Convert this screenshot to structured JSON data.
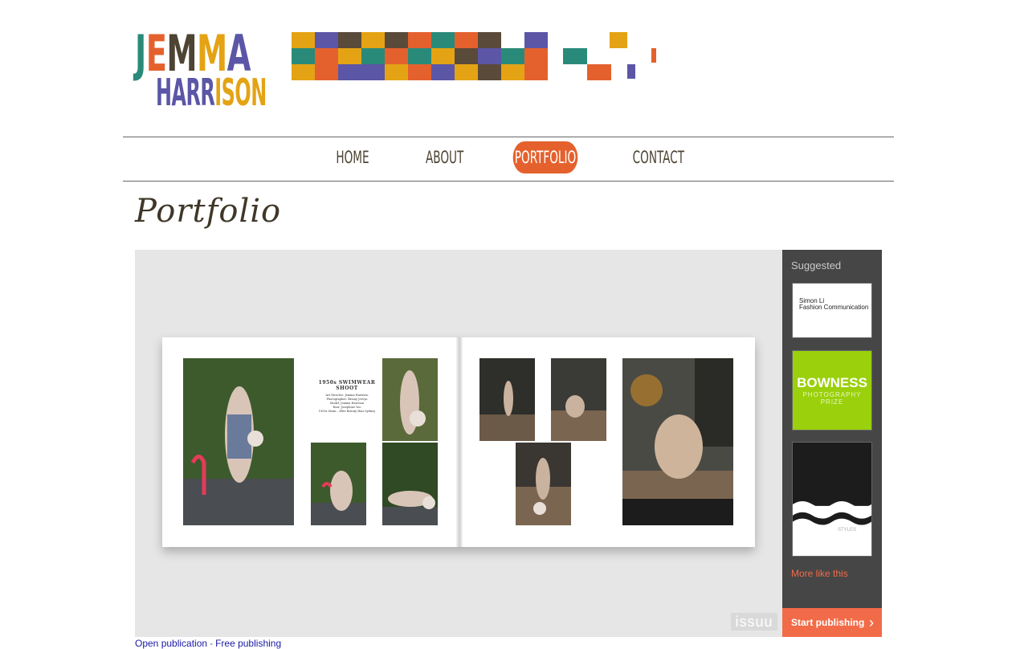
{
  "logo": {
    "line1": [
      "J",
      "E",
      "M",
      "M",
      "A"
    ],
    "line1_colors": [
      "#2a8a7a",
      "#e4612e",
      "#4e4434",
      "#e4a314",
      "#5b56a6"
    ],
    "line2": [
      "H",
      "A",
      "R",
      "R",
      "I",
      "S",
      "O",
      "N"
    ],
    "line2_colors": [
      "#5b56a6",
      "#5b56a6",
      "#5b56a6",
      "#5b56a6",
      "#e4a314",
      "#e4a314",
      "#e4a314",
      "#e4a314"
    ]
  },
  "colors": {
    "accent": "#e4612e",
    "teal": "#2a8a7a",
    "yellow": "#e4a314",
    "purple": "#5b56a6",
    "brown": "#5a4a3a",
    "nav_text": "#4e4434",
    "issuu_orange": "#f26b48",
    "issuu_panel": "#464646",
    "viewer_bg": "#e6e6e6"
  },
  "nav": {
    "items": [
      {
        "label": "Home",
        "active": false
      },
      {
        "label": "About",
        "active": false
      },
      {
        "label": "Portfolio",
        "active": true
      },
      {
        "label": "Contact",
        "active": false
      }
    ]
  },
  "page": {
    "title": "Portfolio"
  },
  "publication": {
    "shoot_title": "1950s SWIMWEAR SHOOT",
    "credits": [
      "Art Director: Jemma Harrison",
      "Photographer: Briony Jervyn",
      "Model: Jemma Harrison",
      "Hair: Josephine Voo",
      "1950s Swim – Elite Beauty Hair Sydney"
    ]
  },
  "issuu": {
    "suggested_label": "Suggested",
    "thumb1_text": [
      "Simon Li",
      "Fashion Communication"
    ],
    "thumb2_title": "BOWNESS",
    "thumb2_subtitle": "PHOTOGRAPHY PRIZE",
    "thumb3_text": "STYLES",
    "more_like_this": "More like this",
    "start_publishing": "Start publishing",
    "watermark": "issuu"
  },
  "footer": {
    "open_publication": "Open publication",
    "separator": "-",
    "free_publishing": "Free publishing"
  }
}
